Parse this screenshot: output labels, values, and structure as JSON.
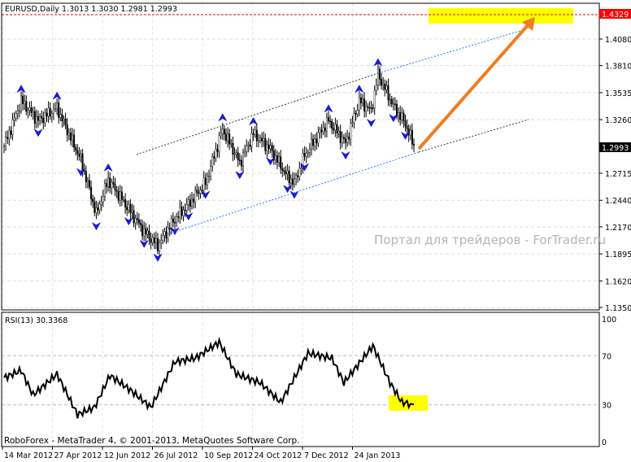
{
  "header": {
    "symbol": "EURUSD,Daily",
    "ohlc": "1.3013 1.3030 1.2981 1.2993"
  },
  "watermark": "Портал для трейдеров - ForTrader.ru",
  "footer": "RoboForex - MetaTrader 4, © 2001-2013, MetaQuotes Software Corp.",
  "rsi_label": "RSI(13) 30.3368",
  "current_price_label": "1.2993",
  "target_price_label": "1.4329",
  "chart_data": [
    {
      "type": "candlestick-bars",
      "title": "EURUSD,Daily",
      "ylim": [
        1.135,
        1.4329
      ],
      "y_ticks": [
        "1.4080",
        "1.3810",
        "1.3535",
        "1.3260",
        "1.2715",
        "1.2440",
        "1.2170",
        "1.1895",
        "1.1620",
        "1.1350"
      ],
      "y_tick_values": [
        1.408,
        1.381,
        1.3535,
        1.326,
        1.2715,
        1.244,
        1.217,
        1.1895,
        1.162,
        1.135
      ],
      "x_ticks": [
        "14 Mar 2012",
        "27 Apr 2012",
        "12 Jun 2012",
        "26 Jul 2012",
        "10 Sep 2012",
        "24 Oct 2012",
        "7 Dec 2012",
        "24 Jan 2013"
      ],
      "bars": 240,
      "close_waypoints": [
        [
          0,
          1.299
        ],
        [
          10,
          1.345
        ],
        [
          20,
          1.325
        ],
        [
          31,
          1.338
        ],
        [
          45,
          1.285
        ],
        [
          54,
          1.23
        ],
        [
          61,
          1.265
        ],
        [
          73,
          1.235
        ],
        [
          82,
          1.212
        ],
        [
          90,
          1.198
        ],
        [
          100,
          1.225
        ],
        [
          108,
          1.24
        ],
        [
          118,
          1.262
        ],
        [
          128,
          1.316
        ],
        [
          138,
          1.282
        ],
        [
          146,
          1.312
        ],
        [
          156,
          1.296
        ],
        [
          166,
          1.268
        ],
        [
          170,
          1.262
        ],
        [
          176,
          1.29
        ],
        [
          190,
          1.325
        ],
        [
          200,
          1.302
        ],
        [
          208,
          1.345
        ],
        [
          215,
          1.335
        ],
        [
          219,
          1.372
        ],
        [
          228,
          1.34
        ],
        [
          235,
          1.322
        ],
        [
          240,
          1.2993
        ]
      ],
      "annotations": {
        "target": 1.4329,
        "current": 1.2993
      }
    },
    {
      "type": "line",
      "title": "RSI(13)",
      "ylim": [
        0,
        100
      ],
      "y_ticks": [
        "100",
        "70",
        "30",
        "0"
      ],
      "levels": [
        70,
        30
      ],
      "waypoints": [
        [
          0,
          52
        ],
        [
          10,
          58
        ],
        [
          17,
          38
        ],
        [
          31,
          55
        ],
        [
          43,
          22
        ],
        [
          53,
          28
        ],
        [
          62,
          54
        ],
        [
          74,
          42
        ],
        [
          86,
          28
        ],
        [
          100,
          65
        ],
        [
          112,
          68
        ],
        [
          126,
          81
        ],
        [
          136,
          55
        ],
        [
          150,
          48
        ],
        [
          162,
          32
        ],
        [
          178,
          72
        ],
        [
          192,
          68
        ],
        [
          199,
          48
        ],
        [
          216,
          78
        ],
        [
          226,
          48
        ],
        [
          233,
          32
        ],
        [
          240,
          30.3368
        ]
      ]
    }
  ]
}
